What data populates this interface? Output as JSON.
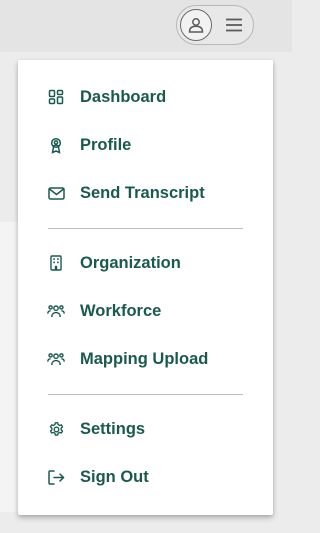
{
  "colors": {
    "accent": "#1a5a4e",
    "menu_bg": "#ffffff",
    "divider": "#bdbdbd"
  },
  "header": {
    "avatar_icon": "user-icon",
    "menu_icon": "hamburger-icon"
  },
  "menu": {
    "sections": [
      {
        "items": [
          {
            "label": "Dashboard",
            "icon": "dashboard-icon"
          },
          {
            "label": "Profile",
            "icon": "profile-badge-icon"
          },
          {
            "label": "Send Transcript",
            "icon": "envelope-icon"
          }
        ]
      },
      {
        "items": [
          {
            "label": "Organization",
            "icon": "building-icon"
          },
          {
            "label": "Workforce",
            "icon": "users-icon"
          },
          {
            "label": "Mapping Upload",
            "icon": "users-icon"
          }
        ]
      },
      {
        "items": [
          {
            "label": "Settings",
            "icon": "gear-icon"
          },
          {
            "label": "Sign Out",
            "icon": "sign-out-icon"
          }
        ]
      }
    ]
  }
}
